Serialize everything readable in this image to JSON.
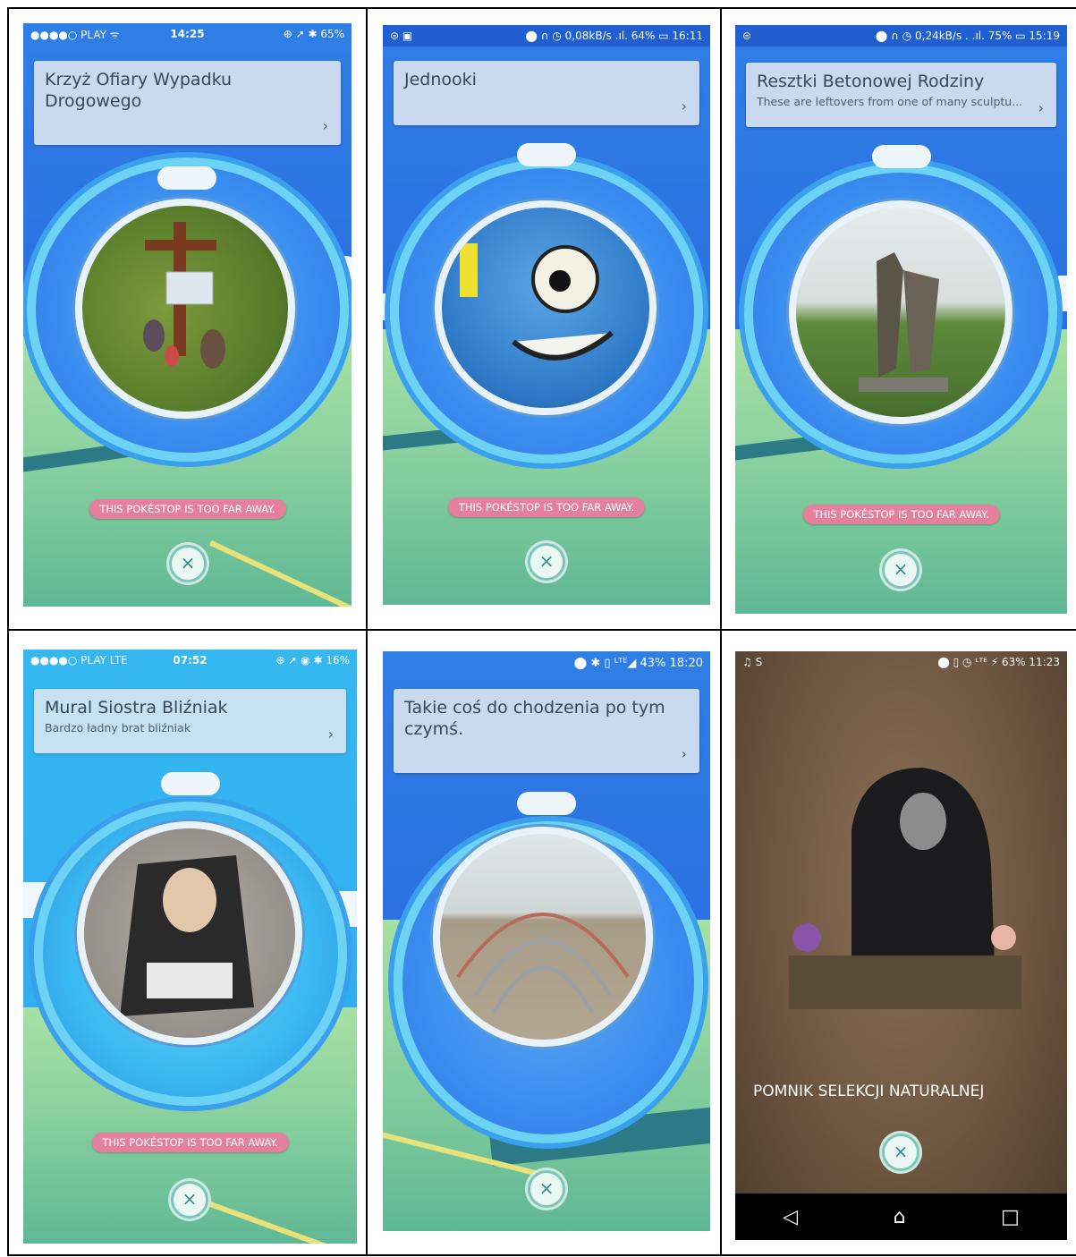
{
  "warning_text": "THIS POKÉSTOP IS TOO FAR AWAY.",
  "close_glyph": "×",
  "screens": [
    {
      "status": {
        "left": "●●●●○ PLAY ᯤ",
        "center": "14:25",
        "right": "⊕ ➚ ✱ 65%"
      },
      "title": "Krzyż Ofiary Wypadku Drogowego",
      "description": "",
      "photo_subject": "roadside-memorial-cross"
    },
    {
      "status": {
        "left": "⊜ ▣",
        "center": "",
        "right": "⬤ ∩ ◷ 0,08kB/s .ıl. 64% ▭ 16:11"
      },
      "title": "Jednooki",
      "description": "",
      "photo_subject": "one-eyed-graffiti"
    },
    {
      "status": {
        "left": "⊜",
        "center": "",
        "right": "⬤ ∩ ◷ 0,24kB/s . .ıl. 75% ▭ 15:19"
      },
      "title": "Resztki Betonowej Rodziny",
      "description": "These are leftovers from one of many sculptu...",
      "photo_subject": "concrete-sculpture"
    },
    {
      "status": {
        "left": "●●●●○ PLAY  LTE",
        "center": "07:52",
        "right": "⊕ ➚ ◉ ✱ 16%"
      },
      "title": "Mural  Siostra Bliźniak",
      "description": "Bardzo ładny brat bliźniak",
      "photo_subject": "nun-mural"
    },
    {
      "status": {
        "left": "",
        "center": "",
        "right": "⬤ ✱ ▯ ᴸᵀᴱ◢ 43% 18:20"
      },
      "title": "Takie coś do chodzenia po tym czymś.",
      "description": "",
      "photo_subject": "playground-climbing-frame"
    },
    {
      "status": {
        "left": "♫ S",
        "center": "",
        "right": "⬤ ▯ ◷ ᴸᵀᴱ ⚡ 63% 11:23"
      },
      "title": "POMNIK SELEKCJI NATURALNEJ",
      "description": "",
      "photo_subject": "memorial-stone"
    }
  ],
  "nav": {
    "back": "◁",
    "home": "⌂",
    "recents": "□"
  }
}
